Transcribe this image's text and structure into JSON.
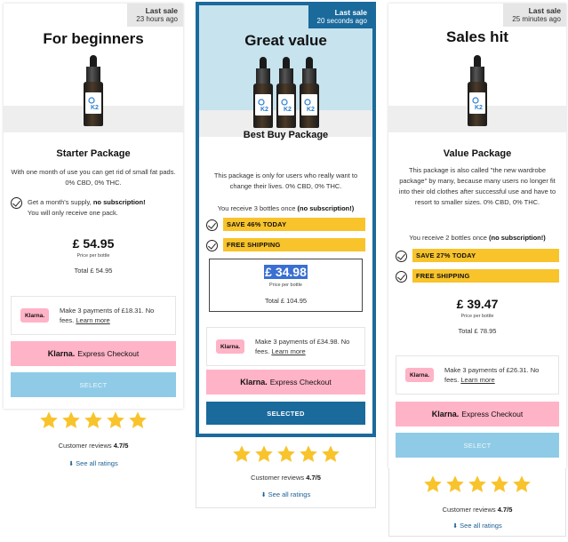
{
  "common": {
    "klarna_logo": "Klarna.",
    "klarna_brand": "Klarna.",
    "express_checkout": "Express Checkout",
    "price_per_bottle": "Price per bottle",
    "see_all_ratings": "See all ratings",
    "reviews_prefix": "Customer reviews",
    "reviews_score": "4.7/5",
    "star_color": "#f8c32b",
    "accent_color": "#1a6a9c",
    "promo_color": "#f8c32b",
    "klarna_pink": "#ffb3c7",
    "k2_label_color": "#2a7fd0"
  },
  "cards": [
    {
      "badge_title": "Last sale",
      "badge_time": "23 hours ago",
      "headline": "For beginners",
      "package_title": "Starter Package",
      "description": "With one month of use you can get rid of small fat pads. 0% CBD, 0% THC.",
      "check_line_1": "Get a month's supply,",
      "check_line_1_bold": "no subscription!",
      "check_line_2": "You will only receive one pack.",
      "price": "£ 54.95",
      "total": "Total £ 54.95",
      "klarna_text": "Make 3 payments of £18.31. No fees.",
      "learn_more": "Learn more",
      "button": "SELECT",
      "bottles": 1
    },
    {
      "badge_title": "Last sale",
      "badge_time": "20 seconds ago",
      "headline": "Great value",
      "package_title": "Best Buy Package",
      "description": "This package is only for users who really want to change their lives. 0% CBD, 0% THC.",
      "receive_text": "You receive 3 bottles once",
      "receive_bold": "(no subscription!)",
      "promo_1": "SAVE 46% TODAY",
      "promo_2": "FREE SHIPPING",
      "price": "£ 34.98",
      "total": "Total £ 104.95",
      "klarna_text": "Make 3 payments of £34.98. No fees.",
      "learn_more": "Learn more",
      "button": "SELECTED",
      "bottles": 3
    },
    {
      "badge_title": "Last sale",
      "badge_time": "25 minutes ago",
      "headline": "Sales hit",
      "package_title": "Value Package",
      "description": "This package is also called \"the new wardrobe package\" by many, because many users no longer fit into their old clothes after successful use and have to resort to smaller sizes. 0% CBD, 0% THC.",
      "receive_text": "You receive 2 bottles once",
      "receive_bold": "(no subscription!)",
      "promo_1": "SAVE 27% TODAY",
      "promo_2": "FREE SHIPPING",
      "price": "£ 39.47",
      "total": "Total £ 78.95",
      "klarna_text": "Make 3 payments of £26.31. No fees.",
      "learn_more": "Learn more",
      "button": "SELECT",
      "bottles": 1
    }
  ]
}
